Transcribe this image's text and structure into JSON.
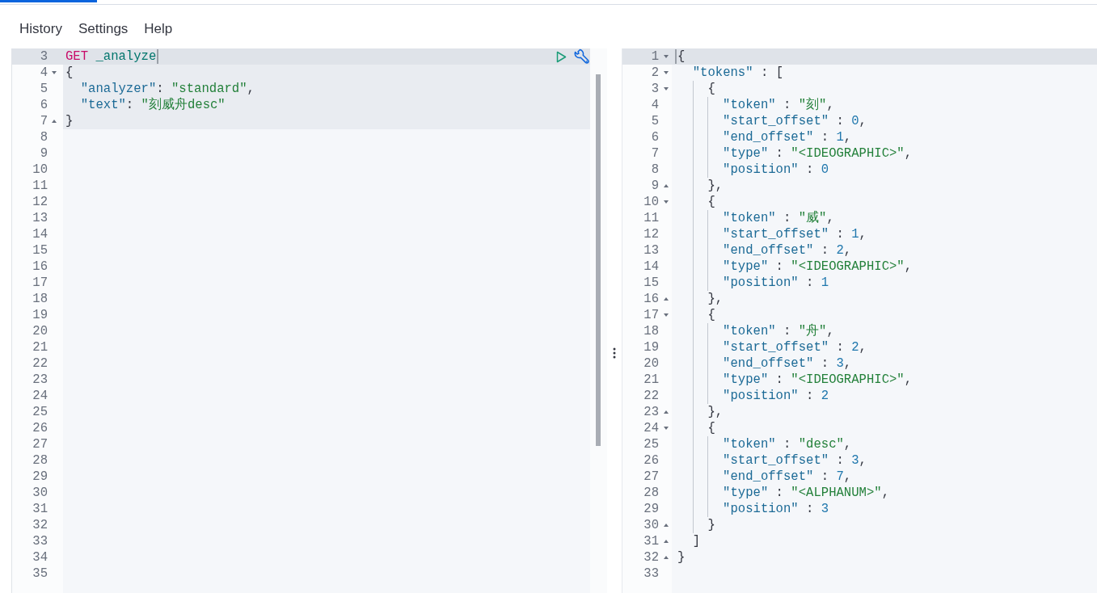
{
  "menu": [
    "History",
    "Settings",
    "Help"
  ],
  "request_editor": {
    "lines": [
      {
        "number": "3",
        "active": true,
        "in_request": true,
        "fold_start": false,
        "fold_end": false,
        "cursor_at_start": false,
        "cursor_at_end": true,
        "code": [
          {
            "kind": "method",
            "text": "GET"
          },
          {
            "kind": "url",
            "text": " _analyze"
          }
        ]
      },
      {
        "number": "4",
        "active": false,
        "in_request": true,
        "fold_start": true,
        "fold_end": false,
        "cursor_at_start": false,
        "cursor_at_end": false,
        "code": [
          {
            "kind": "punct",
            "text": "{"
          }
        ]
      },
      {
        "number": "5",
        "active": false,
        "in_request": true,
        "fold_start": false,
        "fold_end": false,
        "cursor_at_start": false,
        "cursor_at_end": false,
        "code": [
          {
            "kind": "key",
            "text": "  \"analyzer\""
          },
          {
            "kind": "punct",
            "text": ": "
          },
          {
            "kind": "string",
            "text": "\"standard\""
          },
          {
            "kind": "punct",
            "text": ","
          }
        ]
      },
      {
        "number": "6",
        "active": false,
        "in_request": true,
        "fold_start": false,
        "fold_end": false,
        "cursor_at_start": false,
        "cursor_at_end": false,
        "code": [
          {
            "kind": "key",
            "text": "  \"text\""
          },
          {
            "kind": "punct",
            "text": ": "
          },
          {
            "kind": "string",
            "text": "\"刻威舟desc\""
          }
        ]
      },
      {
        "number": "7",
        "active": false,
        "in_request": true,
        "fold_start": false,
        "fold_end": true,
        "cursor_at_start": false,
        "cursor_at_end": false,
        "code": [
          {
            "kind": "punct",
            "text": "}"
          }
        ]
      },
      {
        "number": "8",
        "active": false,
        "in_request": false,
        "fold_start": false,
        "fold_end": false,
        "cursor_at_start": false,
        "cursor_at_end": false
      },
      {
        "number": "9",
        "active": false,
        "in_request": false,
        "fold_start": false,
        "fold_end": false,
        "cursor_at_start": false,
        "cursor_at_end": false
      },
      {
        "number": "10",
        "active": false,
        "in_request": false,
        "fold_start": false,
        "fold_end": false,
        "cursor_at_start": false,
        "cursor_at_end": false
      },
      {
        "number": "11",
        "active": false,
        "in_request": false,
        "fold_start": false,
        "fold_end": false,
        "cursor_at_start": false,
        "cursor_at_end": false
      },
      {
        "number": "12",
        "active": false,
        "in_request": false,
        "fold_start": false,
        "fold_end": false,
        "cursor_at_start": false,
        "cursor_at_end": false
      },
      {
        "number": "13",
        "active": false,
        "in_request": false,
        "fold_start": false,
        "fold_end": false,
        "cursor_at_start": false,
        "cursor_at_end": false
      },
      {
        "number": "14",
        "active": false,
        "in_request": false,
        "fold_start": false,
        "fold_end": false,
        "cursor_at_start": false,
        "cursor_at_end": false
      },
      {
        "number": "15",
        "active": false,
        "in_request": false,
        "fold_start": false,
        "fold_end": false,
        "cursor_at_start": false,
        "cursor_at_end": false
      },
      {
        "number": "16",
        "active": false,
        "in_request": false,
        "fold_start": false,
        "fold_end": false,
        "cursor_at_start": false,
        "cursor_at_end": false
      },
      {
        "number": "17",
        "active": false,
        "in_request": false,
        "fold_start": false,
        "fold_end": false,
        "cursor_at_start": false,
        "cursor_at_end": false
      },
      {
        "number": "18",
        "active": false,
        "in_request": false,
        "fold_start": false,
        "fold_end": false,
        "cursor_at_start": false,
        "cursor_at_end": false
      },
      {
        "number": "19",
        "active": false,
        "in_request": false,
        "fold_start": false,
        "fold_end": false,
        "cursor_at_start": false,
        "cursor_at_end": false
      },
      {
        "number": "20",
        "active": false,
        "in_request": false,
        "fold_start": false,
        "fold_end": false,
        "cursor_at_start": false,
        "cursor_at_end": false
      },
      {
        "number": "21",
        "active": false,
        "in_request": false,
        "fold_start": false,
        "fold_end": false,
        "cursor_at_start": false,
        "cursor_at_end": false
      },
      {
        "number": "22",
        "active": false,
        "in_request": false,
        "fold_start": false,
        "fold_end": false,
        "cursor_at_start": false,
        "cursor_at_end": false
      },
      {
        "number": "23",
        "active": false,
        "in_request": false,
        "fold_start": false,
        "fold_end": false,
        "cursor_at_start": false,
        "cursor_at_end": false
      },
      {
        "number": "24",
        "active": false,
        "in_request": false,
        "fold_start": false,
        "fold_end": false,
        "cursor_at_start": false,
        "cursor_at_end": false
      },
      {
        "number": "25",
        "active": false,
        "in_request": false,
        "fold_start": false,
        "fold_end": false,
        "cursor_at_start": false,
        "cursor_at_end": false
      },
      {
        "number": "26",
        "active": false,
        "in_request": false,
        "fold_start": false,
        "fold_end": false,
        "cursor_at_start": false,
        "cursor_at_end": false
      },
      {
        "number": "27",
        "active": false,
        "in_request": false,
        "fold_start": false,
        "fold_end": false,
        "cursor_at_start": false,
        "cursor_at_end": false
      },
      {
        "number": "28",
        "active": false,
        "in_request": false,
        "fold_start": false,
        "fold_end": false,
        "cursor_at_start": false,
        "cursor_at_end": false
      },
      {
        "number": "29",
        "active": false,
        "in_request": false,
        "fold_start": false,
        "fold_end": false,
        "cursor_at_start": false,
        "cursor_at_end": false
      },
      {
        "number": "30",
        "active": false,
        "in_request": false,
        "fold_start": false,
        "fold_end": false,
        "cursor_at_start": false,
        "cursor_at_end": false
      },
      {
        "number": "31",
        "active": false,
        "in_request": false,
        "fold_start": false,
        "fold_end": false,
        "cursor_at_start": false,
        "cursor_at_end": false
      },
      {
        "number": "32",
        "active": false,
        "in_request": false,
        "fold_start": false,
        "fold_end": false,
        "cursor_at_start": false,
        "cursor_at_end": false
      },
      {
        "number": "33",
        "active": false,
        "in_request": false,
        "fold_start": false,
        "fold_end": false,
        "cursor_at_start": false,
        "cursor_at_end": false
      },
      {
        "number": "34",
        "active": false,
        "in_request": false,
        "fold_start": false,
        "fold_end": false,
        "cursor_at_start": false,
        "cursor_at_end": false
      },
      {
        "number": "35",
        "active": false,
        "in_request": false,
        "fold_start": false,
        "fold_end": false,
        "cursor_at_start": false,
        "cursor_at_end": false
      }
    ]
  },
  "response_editor": {
    "lines": [
      {
        "number": "1",
        "active": true,
        "fold_start": true,
        "fold_end": false,
        "cursor_at_start": true,
        "cursor_at_end": false,
        "code": [
          {
            "kind": "punct",
            "text": "{"
          }
        ]
      },
      {
        "number": "2",
        "active": false,
        "fold_start": true,
        "fold_end": false,
        "cursor_at_start": false,
        "cursor_at_end": false,
        "code": [
          {
            "kind": "key",
            "text": "  \"tokens\""
          },
          {
            "kind": "punct",
            "text": " : ["
          }
        ]
      },
      {
        "number": "3",
        "active": false,
        "fold_start": true,
        "fold_end": false,
        "cursor_at_start": false,
        "cursor_at_end": false,
        "code": [
          {
            "kind": "punct",
            "text": "    {"
          }
        ]
      },
      {
        "number": "4",
        "active": false,
        "fold_start": false,
        "fold_end": false,
        "cursor_at_start": false,
        "cursor_at_end": false,
        "code": [
          {
            "kind": "key",
            "text": "      \"token\""
          },
          {
            "kind": "punct",
            "text": " : "
          },
          {
            "kind": "string",
            "text": "\"刻\""
          },
          {
            "kind": "punct",
            "text": ","
          }
        ]
      },
      {
        "number": "5",
        "active": false,
        "fold_start": false,
        "fold_end": false,
        "cursor_at_start": false,
        "cursor_at_end": false,
        "code": [
          {
            "kind": "key",
            "text": "      \"start_offset\""
          },
          {
            "kind": "punct",
            "text": " : "
          },
          {
            "kind": "number",
            "text": "0"
          },
          {
            "kind": "punct",
            "text": ","
          }
        ]
      },
      {
        "number": "6",
        "active": false,
        "fold_start": false,
        "fold_end": false,
        "cursor_at_start": false,
        "cursor_at_end": false,
        "code": [
          {
            "kind": "key",
            "text": "      \"end_offset\""
          },
          {
            "kind": "punct",
            "text": " : "
          },
          {
            "kind": "number",
            "text": "1"
          },
          {
            "kind": "punct",
            "text": ","
          }
        ]
      },
      {
        "number": "7",
        "active": false,
        "fold_start": false,
        "fold_end": false,
        "cursor_at_start": false,
        "cursor_at_end": false,
        "code": [
          {
            "kind": "key",
            "text": "      \"type\""
          },
          {
            "kind": "punct",
            "text": " : "
          },
          {
            "kind": "string",
            "text": "\"<IDEOGRAPHIC>\""
          },
          {
            "kind": "punct",
            "text": ","
          }
        ]
      },
      {
        "number": "8",
        "active": false,
        "fold_start": false,
        "fold_end": false,
        "cursor_at_start": false,
        "cursor_at_end": false,
        "code": [
          {
            "kind": "key",
            "text": "      \"position\""
          },
          {
            "kind": "punct",
            "text": " : "
          },
          {
            "kind": "number",
            "text": "0"
          }
        ]
      },
      {
        "number": "9",
        "active": false,
        "fold_start": false,
        "fold_end": true,
        "cursor_at_start": false,
        "cursor_at_end": false,
        "code": [
          {
            "kind": "punct",
            "text": "    },"
          }
        ]
      },
      {
        "number": "10",
        "active": false,
        "fold_start": true,
        "fold_end": false,
        "cursor_at_start": false,
        "cursor_at_end": false,
        "code": [
          {
            "kind": "punct",
            "text": "    {"
          }
        ]
      },
      {
        "number": "11",
        "active": false,
        "fold_start": false,
        "fold_end": false,
        "cursor_at_start": false,
        "cursor_at_end": false,
        "code": [
          {
            "kind": "key",
            "text": "      \"token\""
          },
          {
            "kind": "punct",
            "text": " : "
          },
          {
            "kind": "string",
            "text": "\"威\""
          },
          {
            "kind": "punct",
            "text": ","
          }
        ]
      },
      {
        "number": "12",
        "active": false,
        "fold_start": false,
        "fold_end": false,
        "cursor_at_start": false,
        "cursor_at_end": false,
        "code": [
          {
            "kind": "key",
            "text": "      \"start_offset\""
          },
          {
            "kind": "punct",
            "text": " : "
          },
          {
            "kind": "number",
            "text": "1"
          },
          {
            "kind": "punct",
            "text": ","
          }
        ]
      },
      {
        "number": "13",
        "active": false,
        "fold_start": false,
        "fold_end": false,
        "cursor_at_start": false,
        "cursor_at_end": false,
        "code": [
          {
            "kind": "key",
            "text": "      \"end_offset\""
          },
          {
            "kind": "punct",
            "text": " : "
          },
          {
            "kind": "number",
            "text": "2"
          },
          {
            "kind": "punct",
            "text": ","
          }
        ]
      },
      {
        "number": "14",
        "active": false,
        "fold_start": false,
        "fold_end": false,
        "cursor_at_start": false,
        "cursor_at_end": false,
        "code": [
          {
            "kind": "key",
            "text": "      \"type\""
          },
          {
            "kind": "punct",
            "text": " : "
          },
          {
            "kind": "string",
            "text": "\"<IDEOGRAPHIC>\""
          },
          {
            "kind": "punct",
            "text": ","
          }
        ]
      },
      {
        "number": "15",
        "active": false,
        "fold_start": false,
        "fold_end": false,
        "cursor_at_start": false,
        "cursor_at_end": false,
        "code": [
          {
            "kind": "key",
            "text": "      \"position\""
          },
          {
            "kind": "punct",
            "text": " : "
          },
          {
            "kind": "number",
            "text": "1"
          }
        ]
      },
      {
        "number": "16",
        "active": false,
        "fold_start": false,
        "fold_end": true,
        "cursor_at_start": false,
        "cursor_at_end": false,
        "code": [
          {
            "kind": "punct",
            "text": "    },"
          }
        ]
      },
      {
        "number": "17",
        "active": false,
        "fold_start": true,
        "fold_end": false,
        "cursor_at_start": false,
        "cursor_at_end": false,
        "code": [
          {
            "kind": "punct",
            "text": "    {"
          }
        ]
      },
      {
        "number": "18",
        "active": false,
        "fold_start": false,
        "fold_end": false,
        "cursor_at_start": false,
        "cursor_at_end": false,
        "code": [
          {
            "kind": "key",
            "text": "      \"token\""
          },
          {
            "kind": "punct",
            "text": " : "
          },
          {
            "kind": "string",
            "text": "\"舟\""
          },
          {
            "kind": "punct",
            "text": ","
          }
        ]
      },
      {
        "number": "19",
        "active": false,
        "fold_start": false,
        "fold_end": false,
        "cursor_at_start": false,
        "cursor_at_end": false,
        "code": [
          {
            "kind": "key",
            "text": "      \"start_offset\""
          },
          {
            "kind": "punct",
            "text": " : "
          },
          {
            "kind": "number",
            "text": "2"
          },
          {
            "kind": "punct",
            "text": ","
          }
        ]
      },
      {
        "number": "20",
        "active": false,
        "fold_start": false,
        "fold_end": false,
        "cursor_at_start": false,
        "cursor_at_end": false,
        "code": [
          {
            "kind": "key",
            "text": "      \"end_offset\""
          },
          {
            "kind": "punct",
            "text": " : "
          },
          {
            "kind": "number",
            "text": "3"
          },
          {
            "kind": "punct",
            "text": ","
          }
        ]
      },
      {
        "number": "21",
        "active": false,
        "fold_start": false,
        "fold_end": false,
        "cursor_at_start": false,
        "cursor_at_end": false,
        "code": [
          {
            "kind": "key",
            "text": "      \"type\""
          },
          {
            "kind": "punct",
            "text": " : "
          },
          {
            "kind": "string",
            "text": "\"<IDEOGRAPHIC>\""
          },
          {
            "kind": "punct",
            "text": ","
          }
        ]
      },
      {
        "number": "22",
        "active": false,
        "fold_start": false,
        "fold_end": false,
        "cursor_at_start": false,
        "cursor_at_end": false,
        "code": [
          {
            "kind": "key",
            "text": "      \"position\""
          },
          {
            "kind": "punct",
            "text": " : "
          },
          {
            "kind": "number",
            "text": "2"
          }
        ]
      },
      {
        "number": "23",
        "active": false,
        "fold_start": false,
        "fold_end": true,
        "cursor_at_start": false,
        "cursor_at_end": false,
        "code": [
          {
            "kind": "punct",
            "text": "    },"
          }
        ]
      },
      {
        "number": "24",
        "active": false,
        "fold_start": true,
        "fold_end": false,
        "cursor_at_start": false,
        "cursor_at_end": false,
        "code": [
          {
            "kind": "punct",
            "text": "    {"
          }
        ]
      },
      {
        "number": "25",
        "active": false,
        "fold_start": false,
        "fold_end": false,
        "cursor_at_start": false,
        "cursor_at_end": false,
        "code": [
          {
            "kind": "key",
            "text": "      \"token\""
          },
          {
            "kind": "punct",
            "text": " : "
          },
          {
            "kind": "string",
            "text": "\"desc\""
          },
          {
            "kind": "punct",
            "text": ","
          }
        ]
      },
      {
        "number": "26",
        "active": false,
        "fold_start": false,
        "fold_end": false,
        "cursor_at_start": false,
        "cursor_at_end": false,
        "code": [
          {
            "kind": "key",
            "text": "      \"start_offset\""
          },
          {
            "kind": "punct",
            "text": " : "
          },
          {
            "kind": "number",
            "text": "3"
          },
          {
            "kind": "punct",
            "text": ","
          }
        ]
      },
      {
        "number": "27",
        "active": false,
        "fold_start": false,
        "fold_end": false,
        "cursor_at_start": false,
        "cursor_at_end": false,
        "code": [
          {
            "kind": "key",
            "text": "      \"end_offset\""
          },
          {
            "kind": "punct",
            "text": " : "
          },
          {
            "kind": "number",
            "text": "7"
          },
          {
            "kind": "punct",
            "text": ","
          }
        ]
      },
      {
        "number": "28",
        "active": false,
        "fold_start": false,
        "fold_end": false,
        "cursor_at_start": false,
        "cursor_at_end": false,
        "code": [
          {
            "kind": "key",
            "text": "      \"type\""
          },
          {
            "kind": "punct",
            "text": " : "
          },
          {
            "kind": "string",
            "text": "\"<ALPHANUM>\""
          },
          {
            "kind": "punct",
            "text": ","
          }
        ]
      },
      {
        "number": "29",
        "active": false,
        "fold_start": false,
        "fold_end": false,
        "cursor_at_start": false,
        "cursor_at_end": false,
        "code": [
          {
            "kind": "key",
            "text": "      \"position\""
          },
          {
            "kind": "punct",
            "text": " : "
          },
          {
            "kind": "number",
            "text": "3"
          }
        ]
      },
      {
        "number": "30",
        "active": false,
        "fold_start": false,
        "fold_end": true,
        "cursor_at_start": false,
        "cursor_at_end": false,
        "code": [
          {
            "kind": "punct",
            "text": "    }"
          }
        ]
      },
      {
        "number": "31",
        "active": false,
        "fold_start": false,
        "fold_end": true,
        "cursor_at_start": false,
        "cursor_at_end": false,
        "code": [
          {
            "kind": "punct",
            "text": "  ]"
          }
        ]
      },
      {
        "number": "32",
        "active": false,
        "fold_start": false,
        "fold_end": true,
        "cursor_at_start": false,
        "cursor_at_end": false,
        "code": [
          {
            "kind": "punct",
            "text": "}"
          }
        ]
      },
      {
        "number": "33",
        "active": false,
        "fold_start": false,
        "fold_end": false,
        "cursor_at_start": false,
        "cursor_at_end": false
      }
    ]
  }
}
